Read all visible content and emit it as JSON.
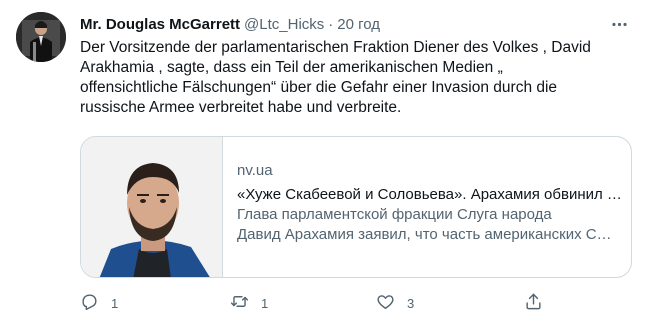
{
  "author": {
    "display_name": "Mr. Douglas McGarrett",
    "handle": "@Ltc_Hicks",
    "separator": "·",
    "time": "20 год"
  },
  "tweet": {
    "lines": [
      "Der Vorsitzende der parlamentarischen Fraktion Diener des Volkes , David",
      "Arakhamia , sagte, dass ein Teil der amerikanischen Medien „",
      "offensichtliche Fälschungen“ über die Gefahr einer Invasion durch die",
      "russische Armee verbreitet habe und verbreite."
    ]
  },
  "card": {
    "domain": "nv.ua",
    "title": "«Хуже Скабеевой и Соловьева». Арахамия обвинил часть американских СМИ",
    "description_lines": [
      "Глава парламентской фракции Слуга народа",
      "Давид Арахамия заявил, что часть американских СМИ распространяет"
    ]
  },
  "actions": {
    "reply_count": "1",
    "retweet_count": "1",
    "like_count": "3"
  },
  "icons": {
    "more": "more-horizontal-icon",
    "reply": "reply-icon",
    "retweet": "retweet-icon",
    "like": "heart-icon",
    "share": "share-icon"
  },
  "colors": {
    "text_primary": "#0f1419",
    "text_secondary": "#536471",
    "border": "#cfd9de"
  }
}
